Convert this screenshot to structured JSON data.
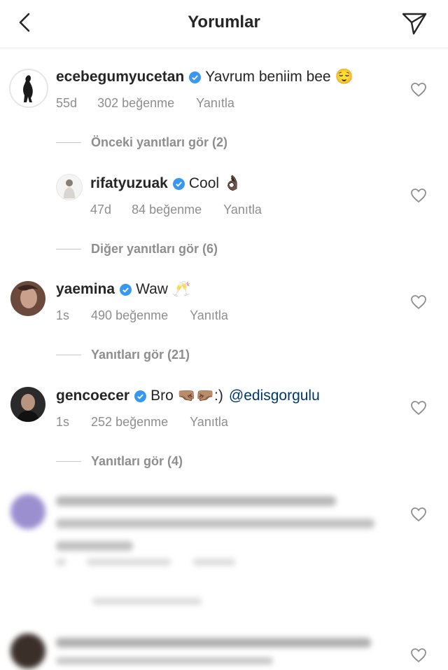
{
  "header": {
    "title": "Yorumlar",
    "back_icon": "chevron-left-icon",
    "send_icon": "paper-plane-icon"
  },
  "comments": [
    {
      "username": "ecebegumyucetan",
      "text": "Yavrum beniim bee",
      "emoji": "😌",
      "time": "55d",
      "likes": "302 beğenme",
      "reply": "Yanıtla",
      "view_replies": "Önceki yanıtları gör (2)"
    },
    {
      "username": "rifatyuzuak",
      "text": "Cool",
      "emoji": "👌🏿",
      "time": "47d",
      "likes": "84 beğenme",
      "reply": "Yanıtla",
      "view_replies": "Diğer yanıtları gör (6)"
    },
    {
      "username": "yaemina",
      "text": "Waw",
      "emoji": "🥂",
      "time": "1s",
      "likes": "490 beğenme",
      "reply": "Yanıtla",
      "view_replies": "Yanıtları gör (21)"
    },
    {
      "username": "gencoecer",
      "text": "Bro",
      "emoji": "🤜🏽🤛🏽",
      "text_after": ":)",
      "mention": "@edisgorgulu",
      "time": "1s",
      "likes": "252 beğenme",
      "reply": "Yanıtla",
      "view_replies": "Yanıtları gör (4)"
    }
  ],
  "colors": {
    "verified": "#3897f0",
    "muted": "#8e8e8e",
    "text": "#262626",
    "mention": "#00376b"
  }
}
